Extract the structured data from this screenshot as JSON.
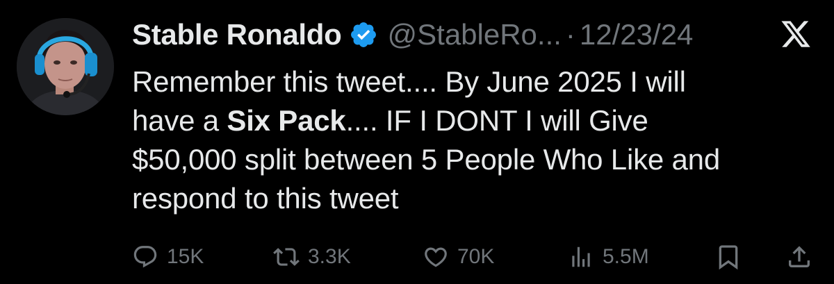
{
  "user": {
    "display_name": "Stable Ronaldo",
    "handle": "@StableRo...",
    "separator": "·",
    "date": "12/23/24",
    "verified": true
  },
  "tweet": {
    "line1": "Remember this tweet.... By June 2025 I will",
    "line2_pre": "have a ",
    "line2_bold": "Six Pack",
    "line2_post": ".... IF I DONT I will Give",
    "line3": "$50,000 split between 5 People Who Like and",
    "line4": "respond to this tweet"
  },
  "actions": {
    "replies": "15K",
    "reposts": "3.3K",
    "likes": "70K",
    "views": "5.5M"
  },
  "colors": {
    "background": "#000000",
    "text": "#e7e9ea",
    "muted": "#71767b",
    "verified": "#1d9bf0"
  },
  "icons": [
    "x-logo-icon",
    "verified-badge-icon",
    "reply-icon",
    "repost-icon",
    "like-icon",
    "views-icon",
    "bookmark-icon",
    "share-icon"
  ]
}
